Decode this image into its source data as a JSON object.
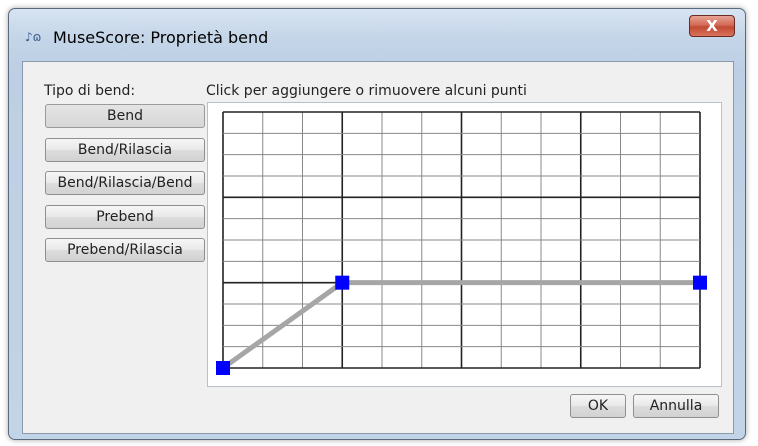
{
  "window": {
    "title": "MuseScore: Proprietà bend",
    "app_icon": "musescore-icon",
    "close_label": "X"
  },
  "panel": {
    "type_label": "Tipo di bend:",
    "instruction": "Click per aggiungere o rimuovere alcuni punti",
    "bend_types": [
      "Bend",
      "Bend/Rilascia",
      "Bend/Rilascia/Bend",
      "Prebend",
      "Prebend/Rilascia"
    ],
    "selected_type": "Bend"
  },
  "graph": {
    "columns": 12,
    "rows": 12,
    "major_column_every": 3,
    "major_row_every": 4,
    "points": [
      {
        "x": 0,
        "y": 0
      },
      {
        "x": 3,
        "y": 4
      },
      {
        "x": 12,
        "y": 4
      }
    ],
    "point_color": "#0000ff",
    "line_color": "#a6a6a6"
  },
  "buttons": {
    "ok": "OK",
    "cancel": "Annulla"
  }
}
